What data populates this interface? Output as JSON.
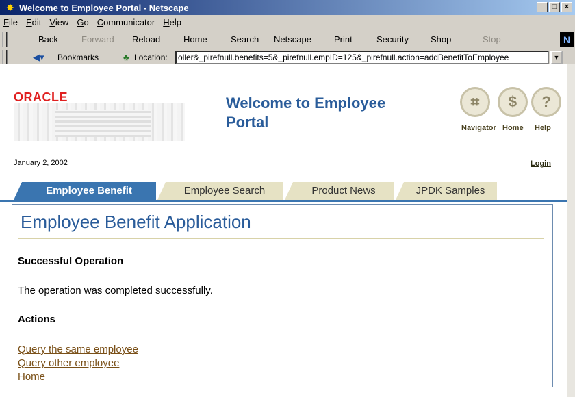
{
  "window": {
    "title": "Welcome to Employee Portal - Netscape",
    "controls": [
      "_",
      "□",
      "×"
    ]
  },
  "menu": [
    "File",
    "Edit",
    "View",
    "Go",
    "Communicator",
    "Help"
  ],
  "toolbar": {
    "back": "Back",
    "forward": "Forward",
    "reload": "Reload",
    "home": "Home",
    "search": "Search",
    "netscape": "Netscape",
    "print": "Print",
    "security": "Security",
    "shop": "Shop",
    "stop": "Stop",
    "brand": "N"
  },
  "location_bar": {
    "bookmarks": "Bookmarks",
    "label": "Location:",
    "url": "oller&_pirefnull.benefits=5&_pirefnull.empID=125&_pirefnull.action=addBenefitToEmployee"
  },
  "header": {
    "logo": "ORACLE",
    "title_line1": "Welcome to Employee",
    "title_line2": "Portal",
    "links": {
      "navigator": "Navigator",
      "home": "Home",
      "help": "Help"
    },
    "date": "January 2, 2002",
    "login": "Login"
  },
  "tabs": [
    {
      "label": "Employee Benefit",
      "active": true
    },
    {
      "label": "Employee Search",
      "active": false
    },
    {
      "label": "Product News",
      "active": false
    },
    {
      "label": "JPDK Samples",
      "active": false
    }
  ],
  "content": {
    "title": "Employee Benefit Application",
    "status_heading": "Successful Operation",
    "message": "The operation was completed successfully.",
    "actions_heading": "Actions",
    "actions": [
      "Query the same employee",
      "Query other employee",
      "Home"
    ]
  },
  "colors": {
    "brand_blue": "#2a5c9a",
    "active_tab": "#3a75b0",
    "inactive_tab": "#e6e2c4",
    "link": "#7a5018",
    "oracle_red": "#e02020"
  }
}
